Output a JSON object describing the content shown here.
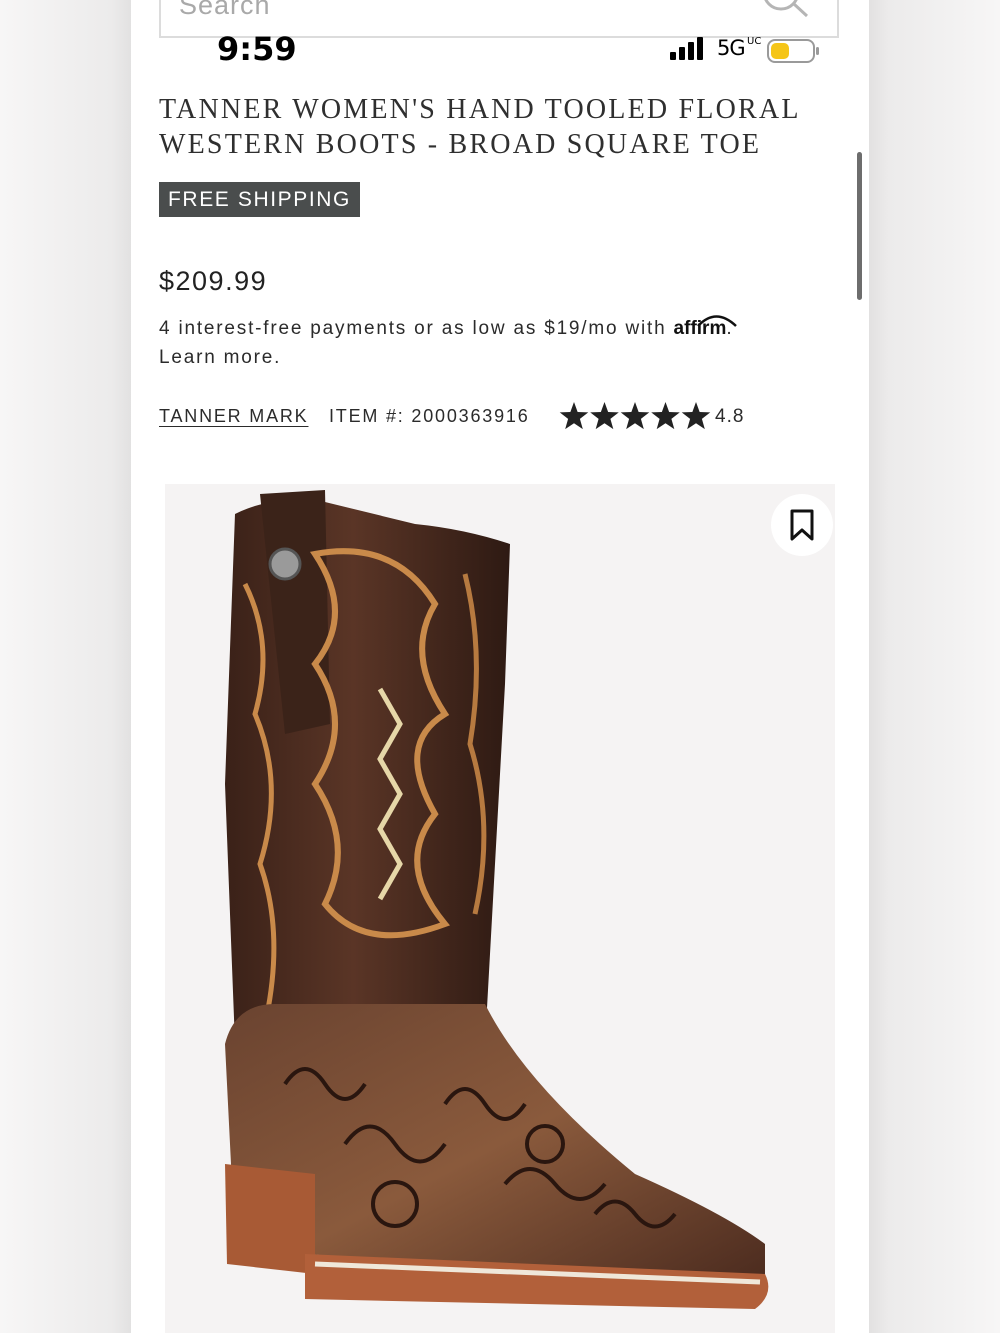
{
  "search": {
    "placeholder": "Search"
  },
  "status_bar": {
    "time": "9:59",
    "network": "5G",
    "network_sub": "UC"
  },
  "product": {
    "title": "TANNER WOMEN'S HAND TOOLED FLORAL WESTERN BOOTS - BROAD SQUARE TOE",
    "badge": "FREE SHIPPING",
    "price": "$209.99",
    "financing_text": "4 interest-free payments or as low as $19/mo with",
    "affirm_logo": "affirm",
    "learn_more": "Learn more.",
    "brand": "TANNER MARK",
    "item_number": "ITEM #: 2000363916",
    "rating": 4.8,
    "rating_text": "4.8",
    "star_count": 5,
    "battery_level": 0.45
  },
  "icons": {
    "search": "search-icon",
    "signal": "signal-icon",
    "battery": "battery-icon",
    "bookmark": "bookmark-icon",
    "star": "star-icon"
  },
  "colors": {
    "badge_bg": "#4a4d4d",
    "battery": "#f5c518",
    "boot_leather": "#4a2a1e",
    "boot_sole": "#b2603a"
  }
}
